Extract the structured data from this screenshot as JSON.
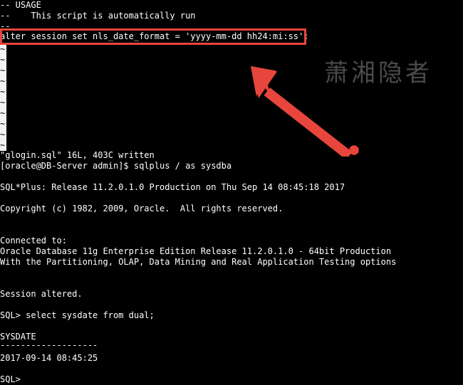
{
  "terminal": {
    "background_color": "#000000",
    "foreground_color": "#ffffff",
    "font_size_px": 12,
    "line_height_px": 15
  },
  "vim": {
    "file_name": "glogin.sql",
    "tilde_marker": "~",
    "tilde_count": 10,
    "lines": [
      "-- USAGE",
      "--    This script is automatically run",
      "--"
    ],
    "highlighted_line": "alter session set nls_date_format = 'yyyy-mm-dd hh24:mi:ss';",
    "status_line": "\"glogin.sql\" 16L, 403C written"
  },
  "shell": {
    "prompt_line": "[oracle@DB-Server admin]$ sqlplus / as sysdba"
  },
  "sqlplus": {
    "banner_release": "SQL*Plus: Release 11.2.0.1.0 Production on Thu Sep 14 08:45:18 2017",
    "banner_copyright": "Copyright (c) 1982, 2009, Oracle.  All rights reserved.",
    "connected_label": "Connected to:",
    "db_version_line": "Oracle Database 11g Enterprise Edition Release 11.2.0.1.0 - 64bit Production",
    "db_options_line": "With the Partitioning, OLAP, Data Mining and Real Application Testing options",
    "session_altered": "Session altered.",
    "query_line": "SQL> select sysdate from dual;",
    "result_header": "SYSDATE",
    "result_separator": "-------------------",
    "result_value": "2017-09-14 08:45:25",
    "final_prompt": "SQL>"
  },
  "annotations": {
    "box_color": "#e8453c",
    "arrow_color": "#e8453c",
    "box_target_text": "alter session set nls_date_format = 'yyyy-mm-dd hh24:mi:ss';",
    "arrow_from": "500,208",
    "arrow_to": "352,93"
  },
  "watermark": {
    "text": "萧湘隐者",
    "color": "#4a4a4a"
  }
}
